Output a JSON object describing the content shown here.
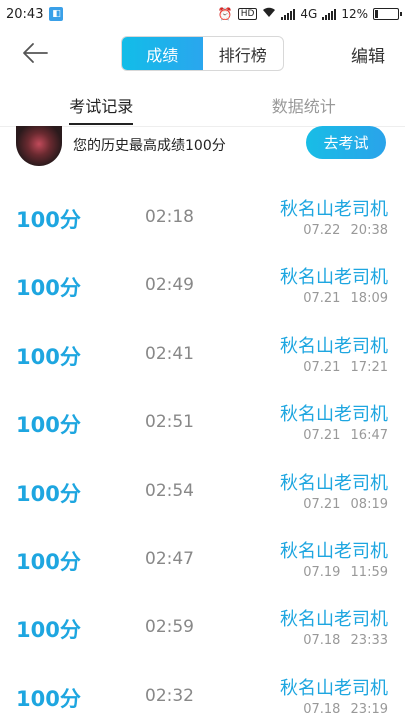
{
  "status_bar": {
    "time": "20:43",
    "network": "4G",
    "battery": "12%",
    "battery_level": 0.12
  },
  "header": {
    "segments": [
      "成绩",
      "排行榜"
    ],
    "active_segment": 0,
    "edit_label": "编辑",
    "back_icon": "arrow-left-icon"
  },
  "tabs": {
    "items": [
      "考试记录",
      "数据统计"
    ],
    "active": 0
  },
  "best": {
    "text": "您的历史最高成绩100分",
    "button": "去考试"
  },
  "records": [
    {
      "score": "100分",
      "duration": "02:18",
      "name": "秋名山老司机",
      "date": "07.22 20:38"
    },
    {
      "score": "100分",
      "duration": "02:49",
      "name": "秋名山老司机",
      "date": "07.21 18:09"
    },
    {
      "score": "100分",
      "duration": "02:41",
      "name": "秋名山老司机",
      "date": "07.21 17:21"
    },
    {
      "score": "100分",
      "duration": "02:51",
      "name": "秋名山老司机",
      "date": "07.21 16:47"
    },
    {
      "score": "100分",
      "duration": "02:54",
      "name": "秋名山老司机",
      "date": "07.21 08:19"
    },
    {
      "score": "100分",
      "duration": "02:47",
      "name": "秋名山老司机",
      "date": "07.19 11:59"
    },
    {
      "score": "100分",
      "duration": "02:59",
      "name": "秋名山老司机",
      "date": "07.18 23:33"
    },
    {
      "score": "100分",
      "duration": "02:32",
      "name": "秋名山老司机",
      "date": "07.18 23:19"
    }
  ],
  "colors": {
    "accent": "#1ea6e0",
    "accent_gradient_start": "#12bde8"
  }
}
